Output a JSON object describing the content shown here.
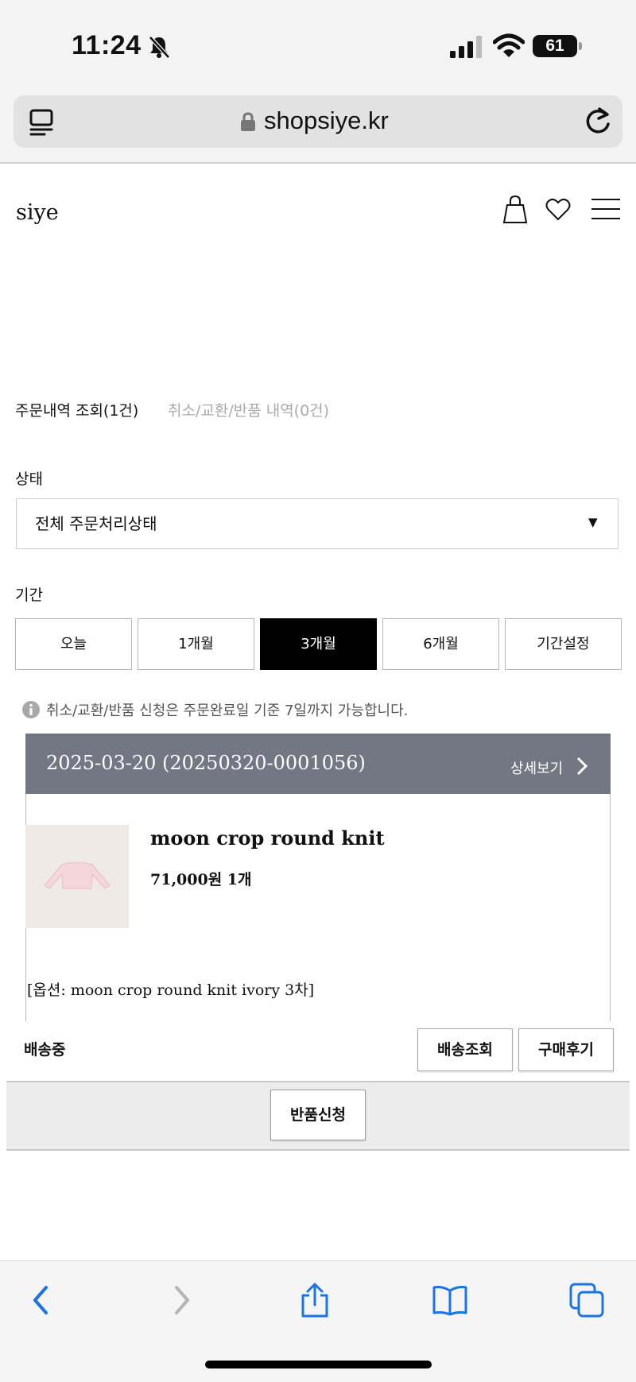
{
  "status_bar": {
    "time": "11:24",
    "battery": "61"
  },
  "browser": {
    "url": "shopsiye.kr"
  },
  "site": {
    "logo": "siye"
  },
  "tabs": {
    "orders": "주문내역 조회(1건)",
    "cancel": "취소/교환/반품 내역(0건)"
  },
  "filter": {
    "status_label": "상태",
    "status_value": "전체 주문처리상태",
    "period_label": "기간",
    "periods": [
      "오늘",
      "1개월",
      "3개월",
      "6개월",
      "기간설정"
    ],
    "active_period": "3개월"
  },
  "notice": "취소/교환/반품 신청은 주문완료일 기준 7일까지 가능합니다.",
  "order": {
    "id": "2025-03-20 (20250320-0001056)",
    "detail_link": "상세보기",
    "product_name": "moon crop round knit",
    "price_qty": "71,000원 1개",
    "option": "[옵션: moon crop round knit ivory 3차]",
    "delivery_status": "배송중",
    "track_button": "배송조회",
    "review_button": "구매후기",
    "return_button": "반품신청"
  },
  "colors": {
    "order_header": "#727783",
    "active_period": "#000000"
  },
  "icons": [
    "bell-slash-icon",
    "signal-icon",
    "wifi-icon",
    "tabs-overview-icon",
    "lock-icon",
    "reload-icon",
    "bag-icon",
    "heart-icon",
    "menu-icon",
    "info-icon",
    "chevron-right-icon",
    "back-icon",
    "forward-icon",
    "share-icon",
    "bookmarks-icon",
    "tabs-icon"
  ]
}
